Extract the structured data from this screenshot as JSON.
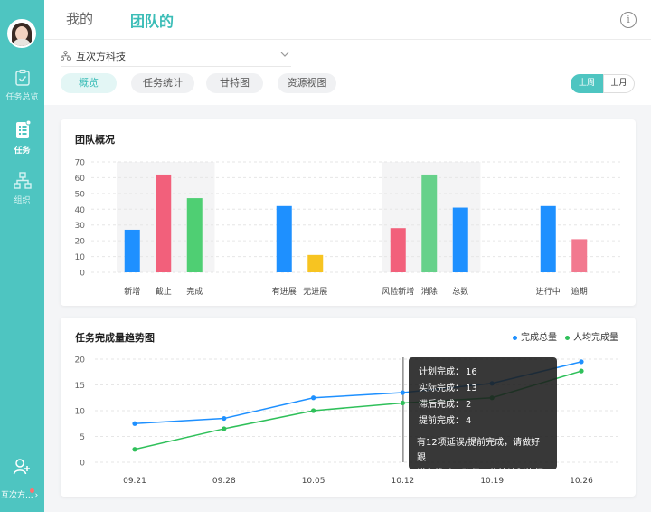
{
  "sidebar": {
    "items": [
      {
        "label": "任务总览",
        "icon": "clipboard-icon"
      },
      {
        "label": "任务",
        "icon": "task-list-icon"
      },
      {
        "label": "组织",
        "icon": "org-chart-icon"
      }
    ],
    "bottom_label": "互次方...",
    "add_member_icon": "add-member-icon"
  },
  "header": {
    "tabs": [
      {
        "label": "我的"
      },
      {
        "label": "团队的"
      }
    ],
    "info_icon": "i"
  },
  "toolbar": {
    "org_name": "互次方科技",
    "view_tabs": [
      {
        "label": "概览"
      },
      {
        "label": "任务统计"
      },
      {
        "label": "甘特图"
      },
      {
        "label": "资源视图"
      }
    ],
    "period": {
      "last_week": "上周",
      "last_month": "上月"
    }
  },
  "colors": {
    "accent": "#4ec5c1",
    "blue": "#1e90ff",
    "red": "#f2607b",
    "green": "#4fcf73",
    "yellow": "#f7c421"
  },
  "chart_data": [
    {
      "type": "bar",
      "title": "团队概况",
      "categories": [
        "新增",
        "截止",
        "完成",
        "有进展",
        "无进展",
        "风险新增",
        "消除",
        "总数",
        "进行中",
        "逾期"
      ],
      "values": [
        27,
        62,
        47,
        42,
        11,
        28,
        62,
        41,
        42,
        21
      ],
      "bar_colors": [
        "#1e90ff",
        "#f2607b",
        "#4fcf73",
        "#1e90ff",
        "#f7c421",
        "#f2607b",
        "#66d18a",
        "#1e90ff",
        "#1e90ff",
        "#f2798f"
      ],
      "groups": [
        [
          0,
          1,
          2
        ],
        [
          3,
          4
        ],
        [
          5,
          6,
          7
        ],
        [
          8,
          9
        ]
      ],
      "shaded_groups": [
        0,
        2
      ],
      "ylim": [
        0,
        70
      ],
      "yticks": [
        0,
        10,
        20,
        30,
        40,
        50,
        60,
        70
      ]
    },
    {
      "type": "line",
      "title": "任务完成量趋势图",
      "x": [
        "09.21",
        "09.28",
        "10.05",
        "10.12",
        "10.19",
        "10.26"
      ],
      "series": [
        {
          "name": "完成总量",
          "color": "#1e90ff",
          "values": [
            7.5,
            8.5,
            12.5,
            13.5,
            15.3,
            19.5
          ]
        },
        {
          "name": "人均完成量",
          "color": "#2fc05a",
          "values": [
            2.5,
            6.5,
            10,
            11.5,
            12.5,
            17.7
          ]
        }
      ],
      "ylim": [
        0,
        20
      ],
      "yticks": [
        0,
        5,
        10,
        15,
        20
      ],
      "legend": "top-right",
      "highlight_x": "10.12"
    }
  ],
  "tooltip": {
    "rows": [
      {
        "label": "计划完成：",
        "value": "16"
      },
      {
        "label": "实际完成：",
        "value": "13"
      },
      {
        "label": "滞后完成：",
        "value": "2"
      },
      {
        "label": "提前完成：",
        "value": "4"
      }
    ],
    "note_line1": "有12项延误/提前完成，请做好跟",
    "note_line2": "讲和推动，确保工作按计划执行"
  }
}
